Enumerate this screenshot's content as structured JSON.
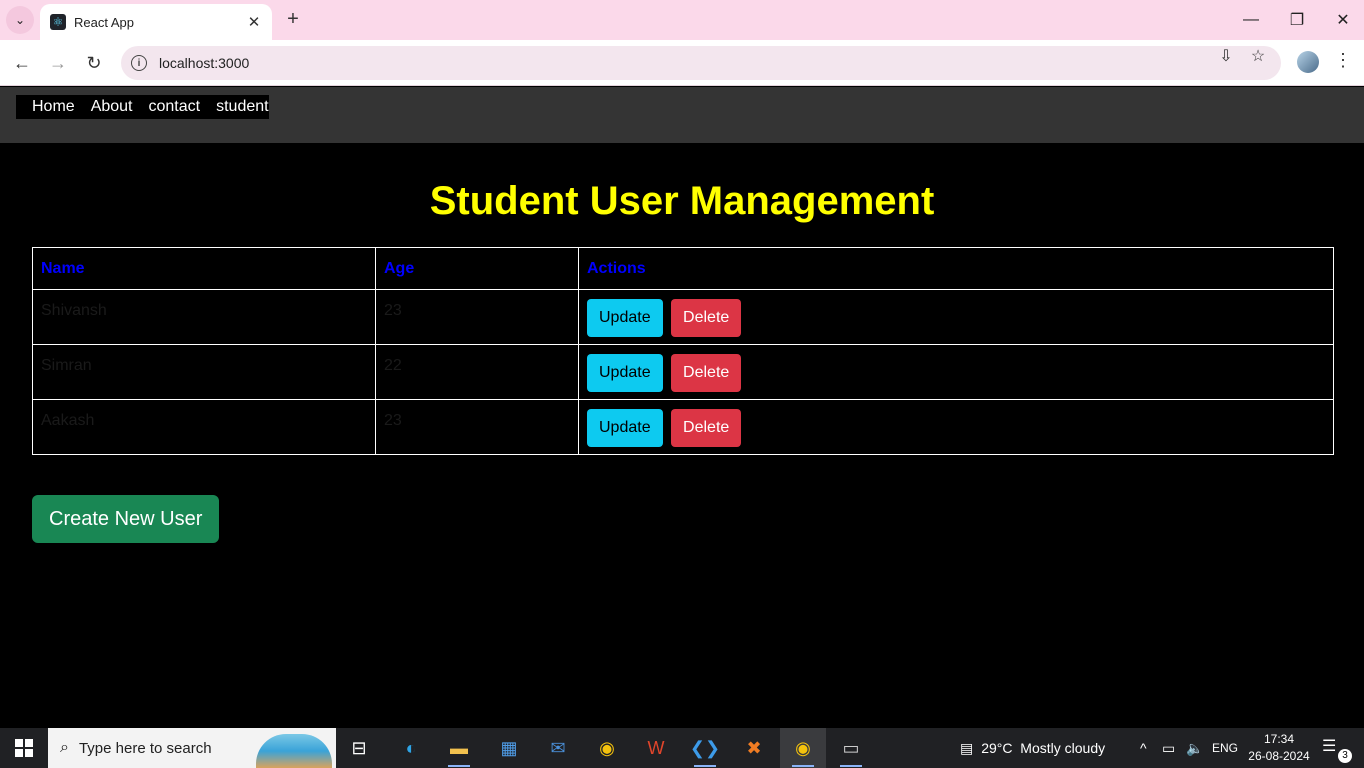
{
  "browser": {
    "tab_title": "React App",
    "url": "localhost:3000"
  },
  "site_nav": {
    "items": [
      "Home",
      "About",
      "contact",
      "student"
    ]
  },
  "main": {
    "title": "Student User Management",
    "table": {
      "headers": [
        "Name",
        "Age",
        "Actions"
      ],
      "rows": [
        {
          "name": "Shivansh",
          "age": "23"
        },
        {
          "name": "Simran",
          "age": "22"
        },
        {
          "name": "Aakash",
          "age": "23"
        }
      ],
      "update_label": "Update",
      "delete_label": "Delete"
    },
    "create_button": "Create New User"
  },
  "taskbar": {
    "search_placeholder": "Type here to search",
    "weather": "29°C  Mostly cloudy",
    "language": "ENG",
    "time": "17:34",
    "date": "26-08-2024",
    "notification_count": "3"
  },
  "colors": {
    "title": "#ffff00",
    "table_header": "#0000ff",
    "update": "#0dcaf0",
    "delete": "#dc3545",
    "create": "#198754"
  }
}
